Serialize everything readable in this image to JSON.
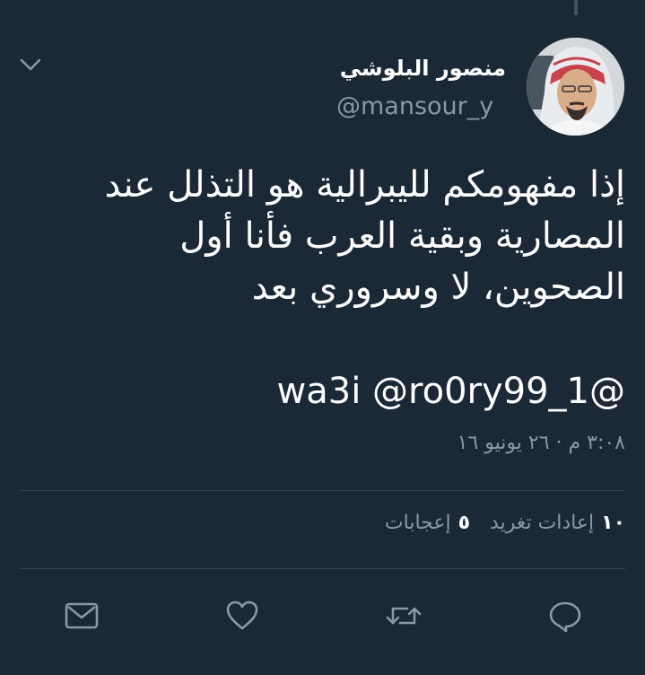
{
  "tweet": {
    "author": {
      "display_name": "منصور البلوشي",
      "handle": "@mansour_y"
    },
    "text_lines": [
      "إذا مفهومكم لليبرالية هو التذلل عند",
      "المصارية وبقية العرب فأنا أول",
      "الصحوين، لا وسروري بعد"
    ],
    "mentions_line": "@1_wa3i @ro0ry99",
    "timestamp": "٣:٠٨ م · ٢٦ يونيو ١٦",
    "stats": {
      "retweets_count": "١٠",
      "retweets_label": "إعادات تغريد",
      "likes_count": "٥",
      "likes_label": "إعجابات"
    }
  },
  "icons": {
    "menu": "chevron-down-icon",
    "reply": "reply-icon",
    "retweet": "retweet-icon",
    "like": "heart-icon",
    "message": "envelope-icon"
  },
  "colors": {
    "background": "#1b2836",
    "text": "#ffffff",
    "secondary_text": "#8899a6",
    "divider": "#38444d"
  }
}
